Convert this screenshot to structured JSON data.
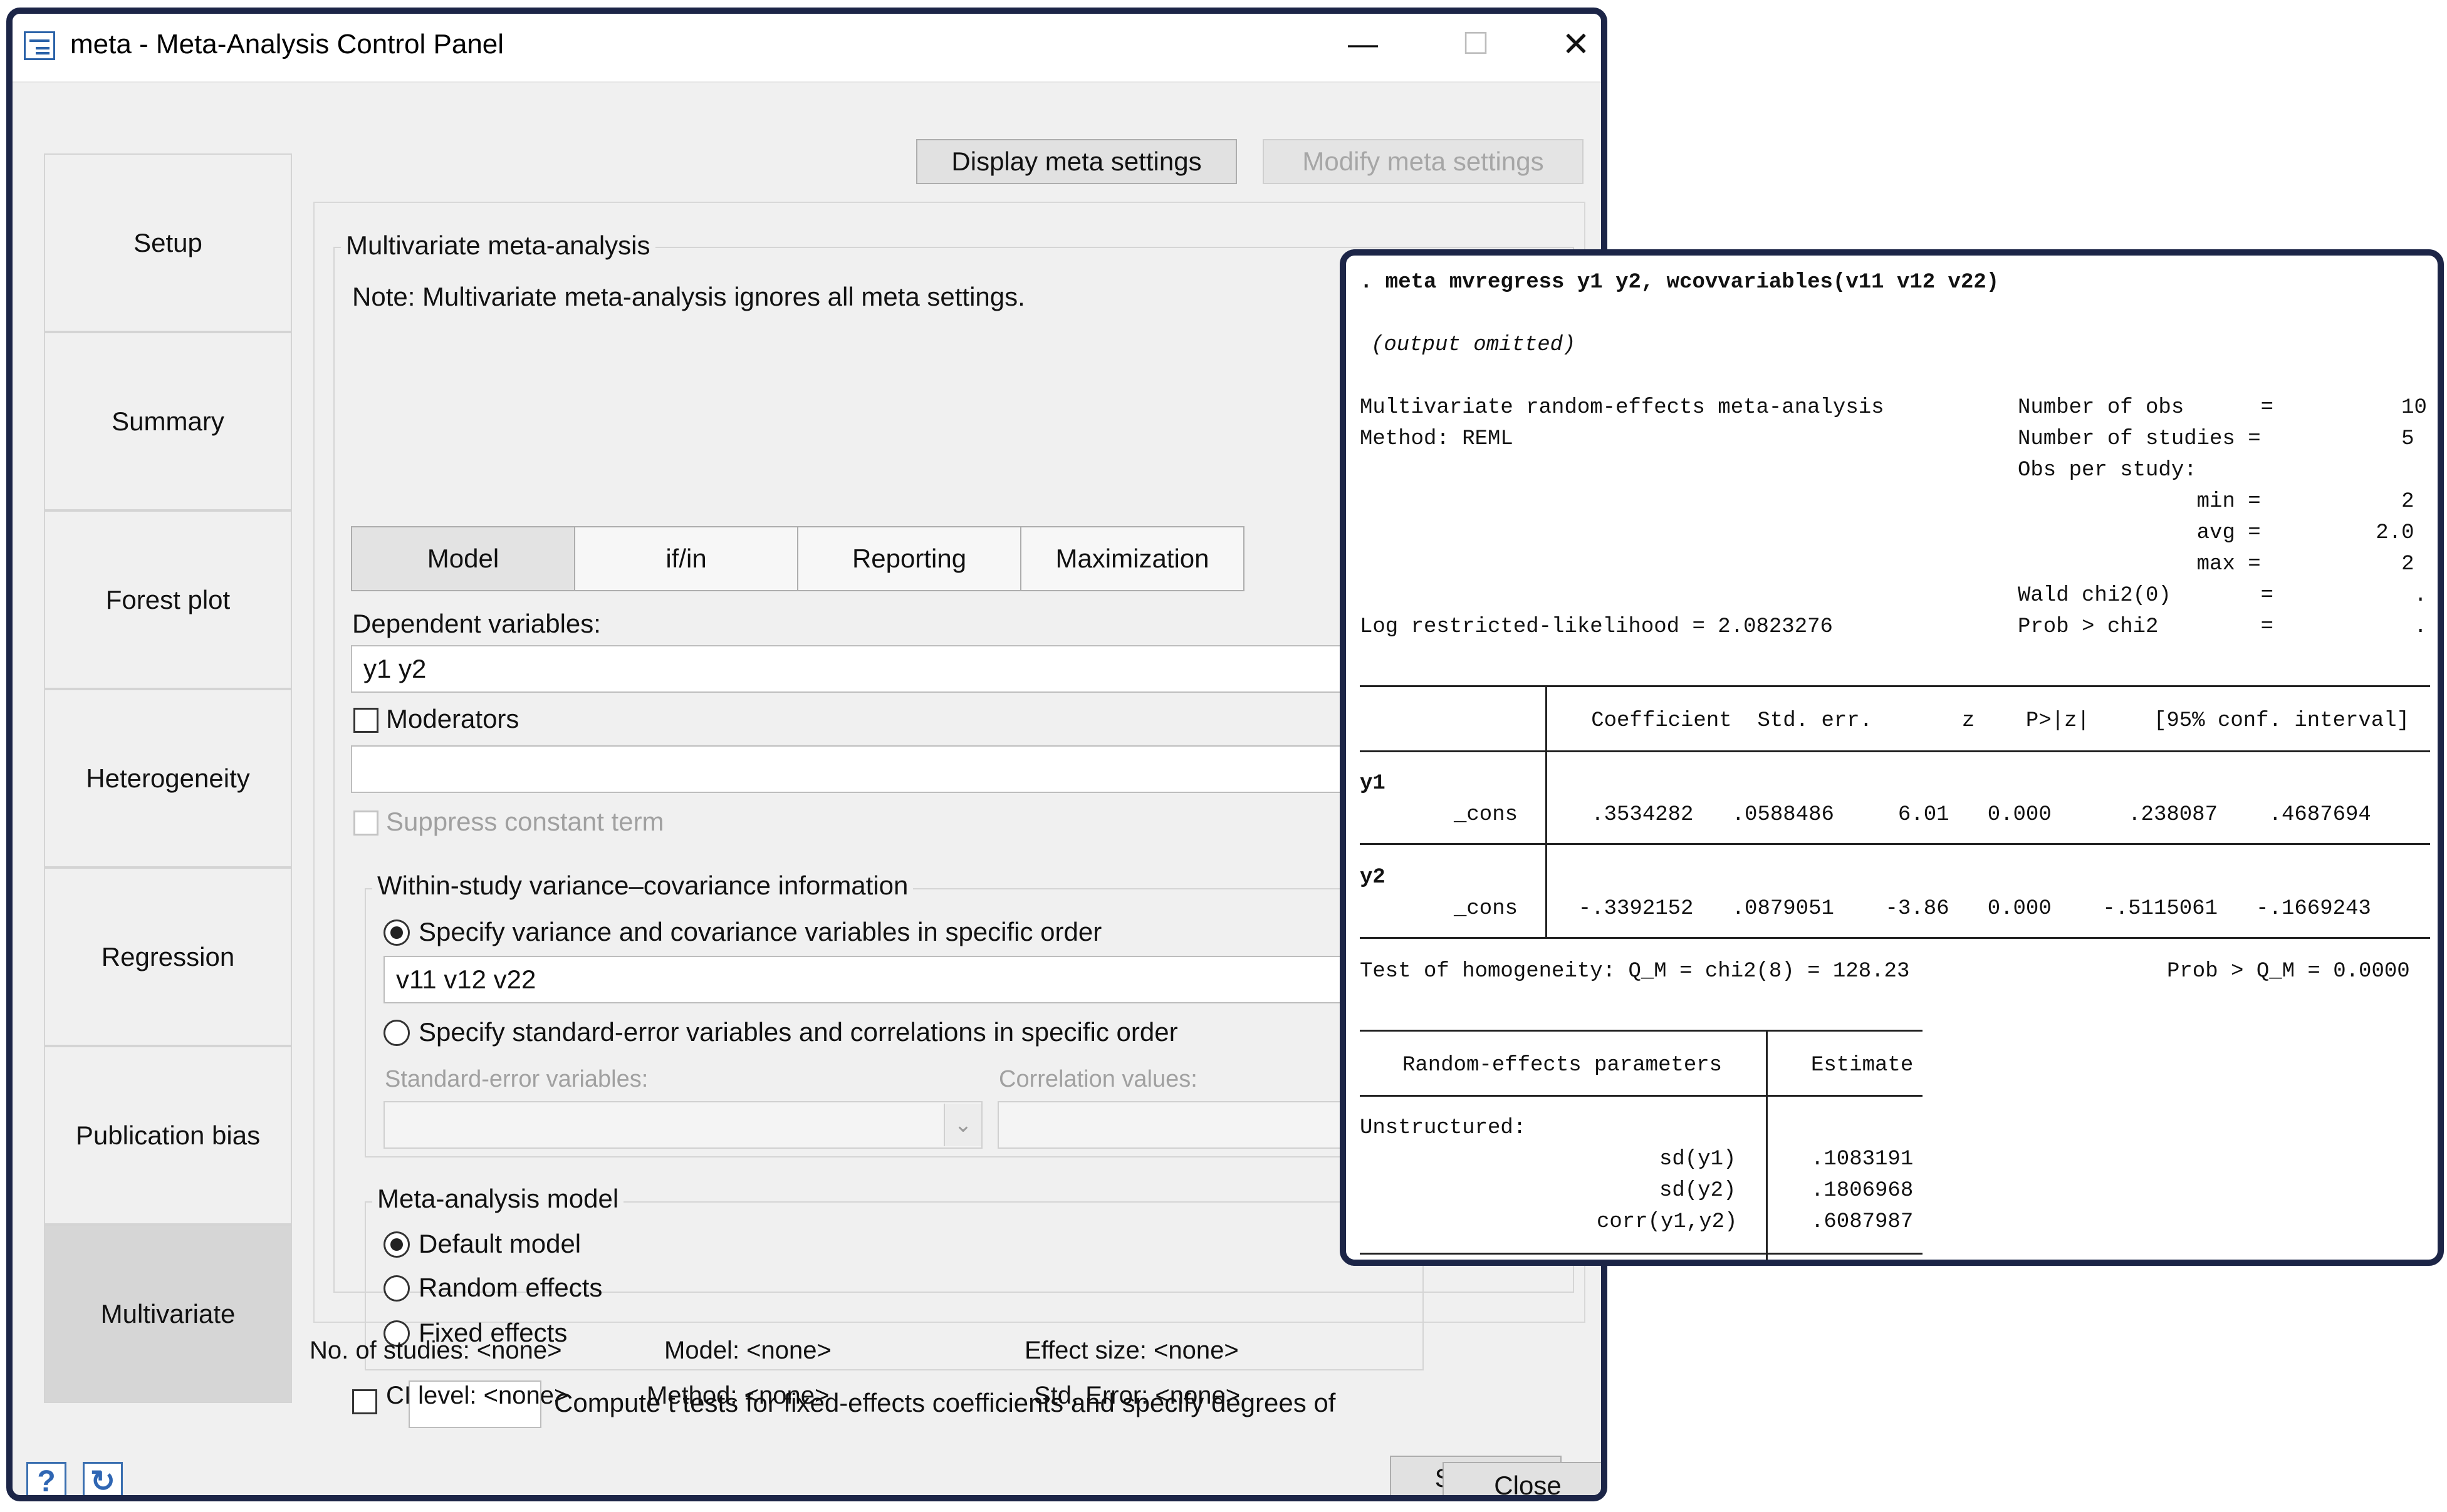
{
  "window": {
    "title": "meta - Meta-Analysis Control Panel",
    "min_glyph": "—",
    "max_glyph": "☐",
    "close_glyph": "✕"
  },
  "nav": {
    "items": [
      "Setup",
      "Summary",
      "Forest plot",
      "Heterogeneity",
      "Regression",
      "Publication bias",
      "Multivariate"
    ],
    "active": "Multivariate"
  },
  "top_buttons": {
    "display": "Display meta settings",
    "modify": "Modify meta settings"
  },
  "multivariate": {
    "group_title": "Multivariate meta-analysis",
    "note": "Note: Multivariate meta-analysis ignores all meta settings.",
    "tabs": [
      "Model",
      "if/in",
      "Reporting",
      "Maximization"
    ],
    "active_tab": "Model",
    "dependent_label": "Dependent variables:",
    "dependent_value": "y1 y2",
    "moderators_label": "Moderators",
    "moderators_value": "",
    "suppress_label": "Suppress constant term",
    "within_group_title": "Within-study variance–covariance information",
    "radio_specify_var": "Specify variance and covariance variables in specific order",
    "var_value": "v11 v12 v22",
    "radio_specify_se": "Specify standard-error variables and correlations in specific order",
    "se_label": "Standard-error variables:",
    "corr_label": "Correlation values:",
    "model_group_title": "Meta-analysis model",
    "model_options": [
      "Default model",
      "Random effects",
      "Fixed effects"
    ],
    "model_selected": "Default model",
    "ttest_label": "Compute t tests for fixed-effects coefficients and specify degrees of",
    "submit": "Submit"
  },
  "status": {
    "studies": "No. of studies: <none>",
    "model": "Model: <none>",
    "effect": "Effect size: <none>",
    "ci": "CI level: <none>",
    "method": "Method: <none>",
    "stderr": "Std. Error: <none>"
  },
  "bottom": {
    "help": "?",
    "refresh": "↻",
    "close": "Close"
  },
  "output": {
    "command": ". meta mvregress y1 y2, wcovvariables(v11 v12 v22)",
    "omitted": "(output omitted)",
    "header_left": [
      "Multivariate random-effects meta-analysis",
      "Method: REML"
    ],
    "header_right": [
      "Number of obs      =          10",
      "Number of studies =           5",
      "Obs per study:",
      "              min =           2",
      "              avg =         2.0",
      "              max =           2",
      "Wald chi2(0)       =           .",
      "Prob > chi2        =           ."
    ],
    "loglik": "Log restricted-likelihood = 2.0823276",
    "table_header": "   Coefficient  Std. err.       z    P>|z|     [95% conf. interval]",
    "rows": [
      {
        "eq": "y1",
        "name": "_cons",
        "values": "   .3534282   .0588486     6.01   0.000      .238087    .4687694"
      },
      {
        "eq": "y2",
        "name": "_cons",
        "values": "  -.3392152   .0879051    -3.86   0.000    -.5115061   -.1669243"
      }
    ],
    "homogeneity_left": "Test of homogeneity: Q_M = chi2(8) = 128.23",
    "homogeneity_right": "Prob > Q_M = 0.0000",
    "re_header_left": "Random-effects parameters",
    "re_header_right": "Estimate",
    "re_section": "Unstructured:",
    "re_rows": [
      {
        "name": "sd(y1)",
        "value": ".1083191"
      },
      {
        "name": "sd(y2)",
        "value": ".1806968"
      },
      {
        "name": "corr(y1,y2)",
        "value": ".6087987"
      }
    ]
  }
}
